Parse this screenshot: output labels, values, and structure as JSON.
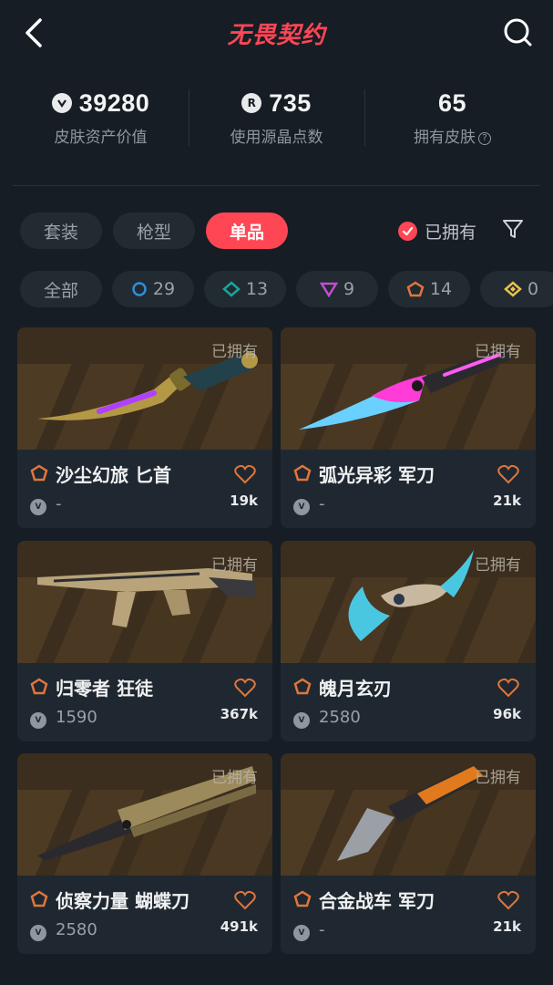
{
  "header": {
    "title": "无畏契约"
  },
  "stats": [
    {
      "value": "39280",
      "label": "皮肤资产价值",
      "icon": "vp-coin-icon"
    },
    {
      "value": "735",
      "label": "使用源晶点数",
      "icon": "radianite-icon"
    },
    {
      "value": "65",
      "label": "拥有皮肤",
      "icon": "help-icon"
    }
  ],
  "tabs": [
    "套装",
    "枪型",
    "单品"
  ],
  "active_tab": "单品",
  "owned_filter": {
    "label": "已拥有",
    "checked": true
  },
  "rarity_filters": [
    {
      "label": "全部"
    },
    {
      "count": "29",
      "color": "#2f8fd8"
    },
    {
      "count": "13",
      "color": "#1aa69a"
    },
    {
      "count": "9",
      "color": "#c04fd0"
    },
    {
      "count": "14",
      "color": "#e0763c"
    },
    {
      "count": "0",
      "color": "#e8c24a"
    }
  ],
  "skins": [
    {
      "name": "沙尘幻旅 匕首",
      "price": "-",
      "likes": "19k",
      "owned": "已拥有"
    },
    {
      "name": "弧光异彩 军刀",
      "price": "-",
      "likes": "21k",
      "owned": "已拥有"
    },
    {
      "name": "归零者 狂徒",
      "price": "1590",
      "likes": "367k",
      "owned": "已拥有"
    },
    {
      "name": "魄月玄刃",
      "price": "2580",
      "likes": "96k",
      "owned": "已拥有"
    },
    {
      "name": "侦察力量 蝴蝶刀",
      "price": "2580",
      "likes": "491k",
      "owned": "已拥有"
    },
    {
      "name": "合金战车 军刀",
      "price": "-",
      "likes": "21k",
      "owned": "已拥有"
    }
  ],
  "colors": {
    "accent": "#ff4655",
    "background": "#161d24",
    "card": "#1f2830",
    "tier_exclusive": "#e0763c"
  }
}
